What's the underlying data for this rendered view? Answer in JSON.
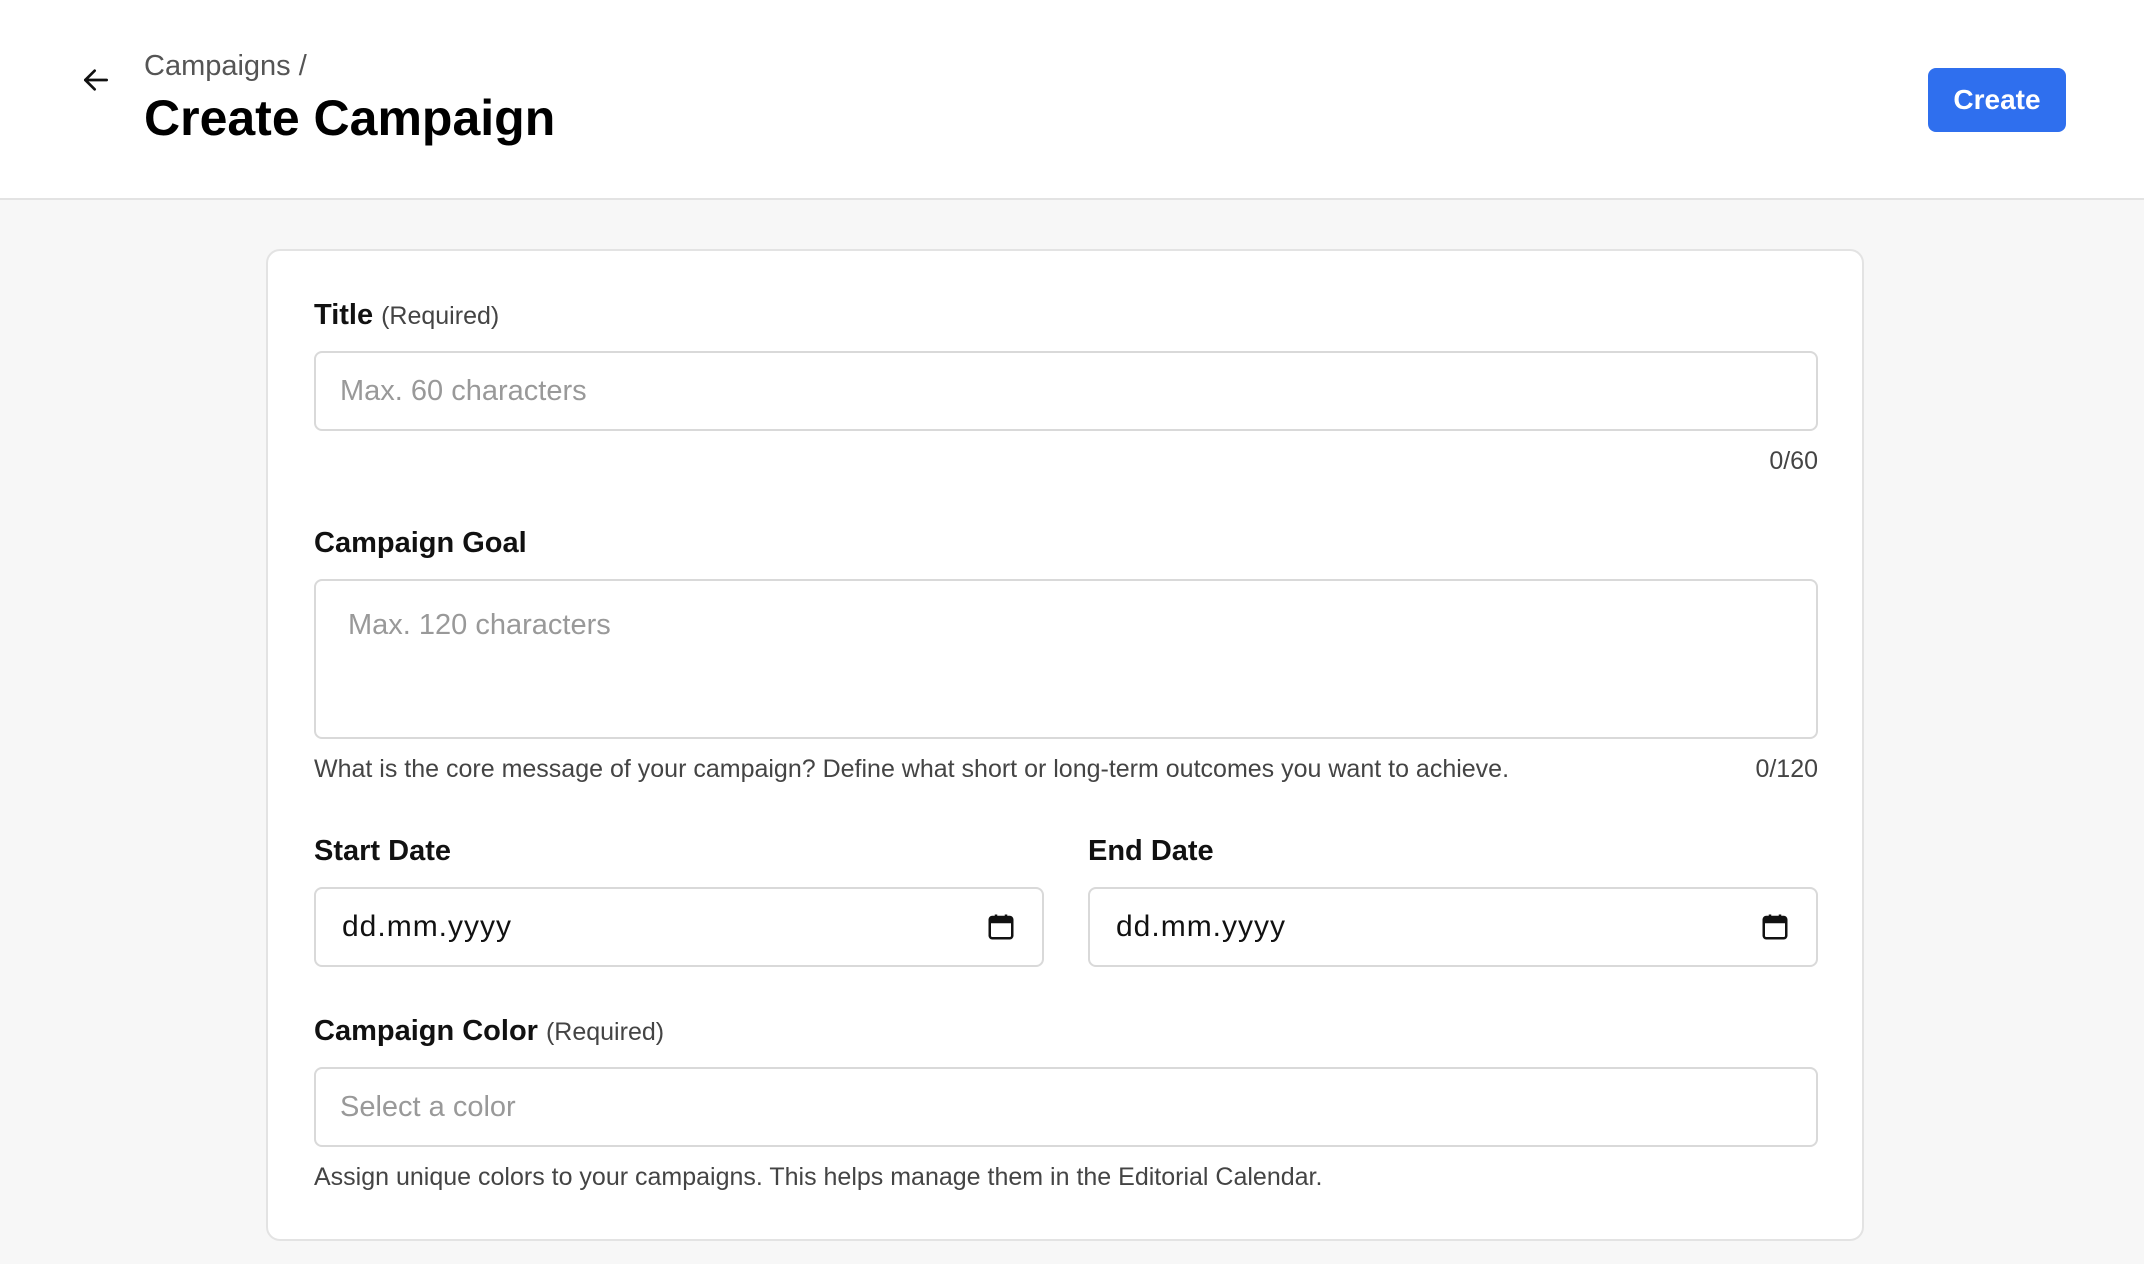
{
  "header": {
    "breadcrumb": "Campaigns /",
    "title": "Create Campaign",
    "create_label": "Create"
  },
  "form": {
    "title_field": {
      "label": "Title",
      "required_note": "(Required)",
      "placeholder": "Max. 60 characters",
      "counter": "0/60"
    },
    "goal_field": {
      "label": "Campaign Goal",
      "placeholder": "Max. 120 characters",
      "hint": "What is the core message of your campaign? Define what short or long-term outcomes you want to achieve.",
      "counter": "0/120"
    },
    "start_date": {
      "label": "Start Date",
      "value": "dd.mm.yyyy"
    },
    "end_date": {
      "label": "End Date",
      "value": "dd.mm.yyyy"
    },
    "color_field": {
      "label": "Campaign Color",
      "required_note": "(Required)",
      "placeholder": "Select a color",
      "hint": "Assign unique colors to your campaigns. This helps manage them in the Editorial Calendar."
    }
  },
  "colors": {
    "accent": "#2f6fee",
    "background": "#f7f7f7",
    "border": "#d9d9d9"
  },
  "icons": {
    "back": "arrow-left-icon",
    "calendar": "calendar-icon"
  }
}
